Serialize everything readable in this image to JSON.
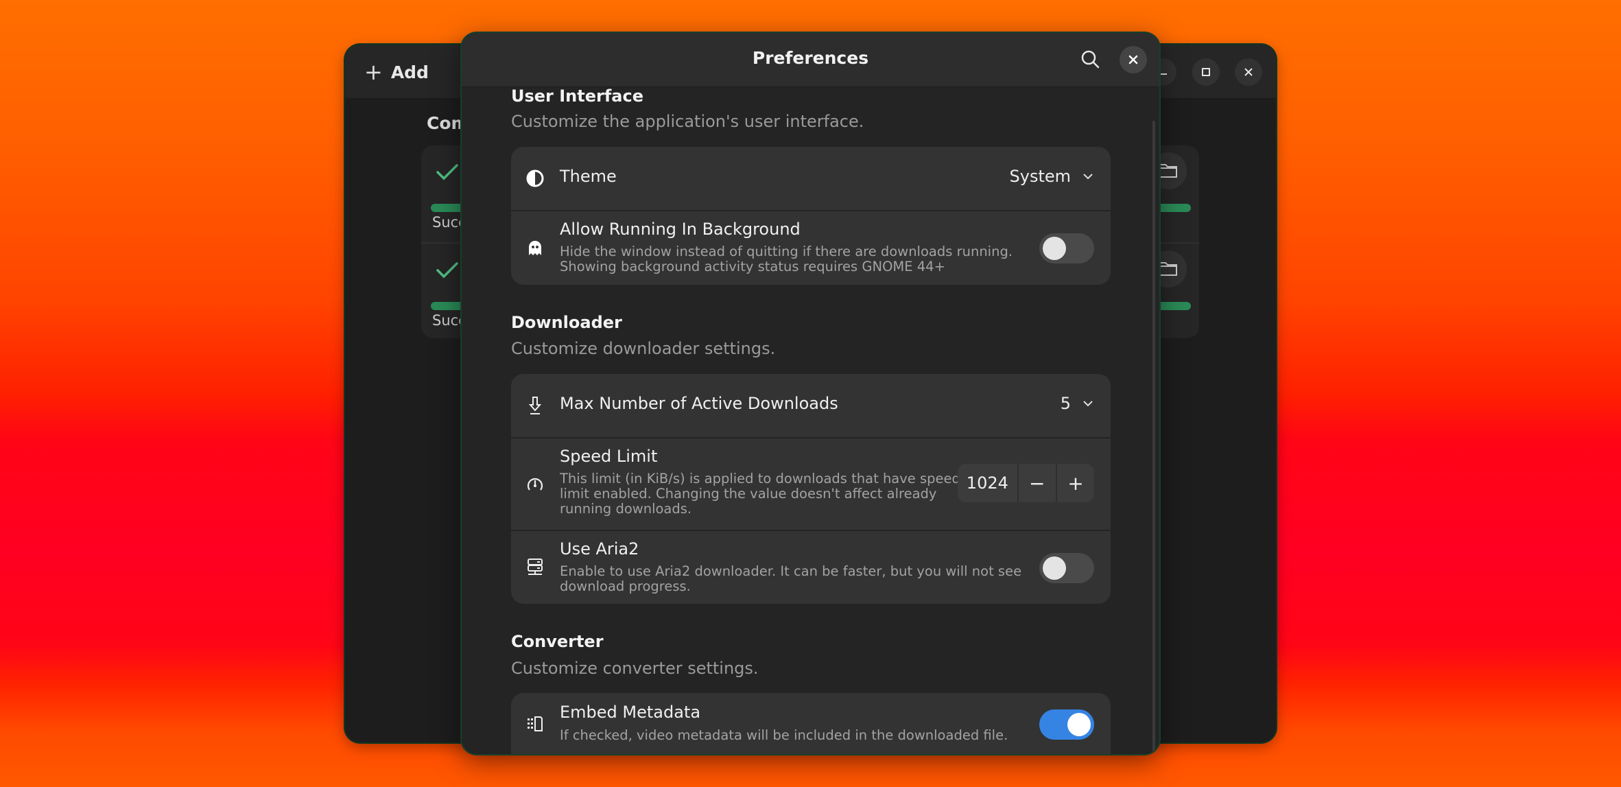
{
  "background_window": {
    "add_button_label": "Add",
    "section_title_partial": "Com",
    "window_controls": {
      "minimize": "minimize-icon",
      "maximize": "maximize-icon",
      "close": "close-icon"
    },
    "downloads": [
      {
        "status_partial": "Succ",
        "progress": 1.0,
        "state_icon": "checkmark-icon",
        "action_icon": "folder-icon"
      },
      {
        "status_partial": "Succ",
        "progress": 1.0,
        "state_icon": "checkmark-icon",
        "action_icon": "folder-icon"
      }
    ]
  },
  "dialog": {
    "title": "Preferences",
    "search_icon": "search-icon",
    "close_icon": "close-icon",
    "groups": [
      {
        "title": "User Interface",
        "subtitle": "Customize the application's user interface.",
        "rows": [
          {
            "icon": "theme-icon",
            "title": "Theme",
            "control": "dropdown",
            "value": "System"
          },
          {
            "icon": "ghost-icon",
            "title": "Allow Running In Background",
            "description": "Hide the window instead of quitting if there are downloads running. Showing background activity status requires GNOME 44+",
            "description_lines": [
              "Hide the window instead of quitting if there are downloads running.",
              "Showing background activity status requires GNOME 44+"
            ],
            "control": "switch",
            "checked": false
          }
        ]
      },
      {
        "title": "Downloader",
        "subtitle": "Customize downloader settings.",
        "rows": [
          {
            "icon": "download-icon",
            "title": "Max Number of Active Downloads",
            "control": "dropdown",
            "value": "5"
          },
          {
            "icon": "speedometer-icon",
            "title": "Speed Limit",
            "description": "This limit (in KiB/s) is applied to downloads that have speed limit enabled. Changing the value doesn't affect already running downloads.",
            "description_lines": [
              "This limit (in KiB/s) is applied to downloads that have speed",
              "limit enabled. Changing the value doesn't affect already",
              "running downloads."
            ],
            "control": "spinbutton",
            "value": "1024",
            "decrement_label": "−",
            "increment_label": "+"
          },
          {
            "icon": "server-icon",
            "title": "Use Aria2",
            "description": "Enable to use Aria2 downloader. It can be faster, but you will not see download progress.",
            "description_lines": [
              "Enable to use Aria2 downloader. It can be faster, but you will not see",
              "download progress."
            ],
            "control": "switch",
            "checked": false
          }
        ]
      },
      {
        "title": "Converter",
        "subtitle": "Customize converter settings.",
        "rows": [
          {
            "icon": "metadata-icon",
            "title": "Embed Metadata",
            "description": "If checked, video metadata will be included in the downloaded file.",
            "control": "switch",
            "checked": true
          }
        ]
      }
    ]
  },
  "colors": {
    "accent": "#3584e4",
    "success": "#2a8a57",
    "dialog_bg": "#242424",
    "card_bg": "#333333"
  }
}
